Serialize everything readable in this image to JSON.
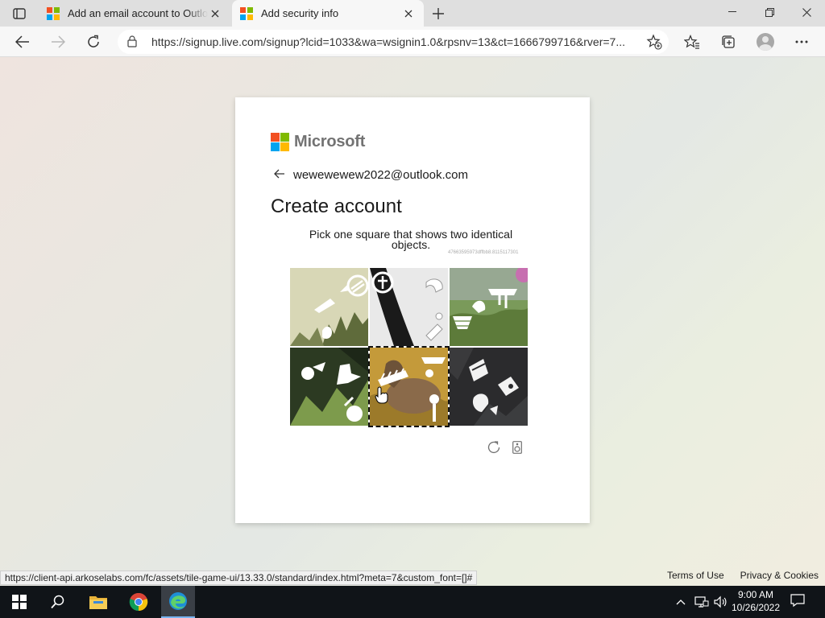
{
  "browser": {
    "tabs": [
      {
        "title": "Add an email account to Outlook"
      },
      {
        "title": "Add security info"
      }
    ],
    "url": "https://signup.live.com/signup?lcid=1033&wa=wsignin1.0&rpsnv=13&ct=1666799716&rver=7..."
  },
  "page": {
    "brand": "Microsoft",
    "email": "wewewewew2022@outlook.com",
    "title": "Create account",
    "challenge_line1": "Pick one square that shows two identical",
    "challenge_line2": "objects.",
    "session_id": "47663595973dffbb8.8115117301",
    "footer": {
      "terms": "Terms of Use",
      "privacy": "Privacy & Cookies"
    }
  },
  "status_url": "https://client-api.arkoselabs.com/fc/assets/tile-game-ui/13.33.0/standard/index.html?meta=7&custom_font=[]#",
  "colors": {
    "accent_edge": "#0078d4",
    "card": "#ffffff"
  },
  "taskbar": {
    "time": "9:00 AM",
    "date": "10/26/2022"
  }
}
